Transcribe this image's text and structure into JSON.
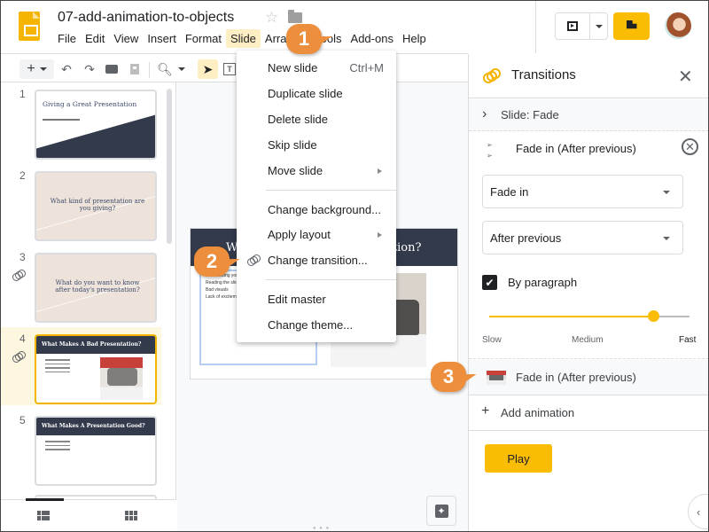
{
  "header": {
    "doc_title": "07-add-animation-to-objects",
    "menu": [
      "File",
      "Edit",
      "View",
      "Insert",
      "Format",
      "Slide",
      "Arrange",
      "Tools",
      "Add-ons",
      "Help"
    ],
    "active_menu": "Slide"
  },
  "toolbar": {
    "items": [
      "new-slide",
      "new-slide-dropdown",
      "undo",
      "redo",
      "print",
      "paint-format",
      "zoom",
      "zoom-dropdown",
      "select",
      "text-box"
    ]
  },
  "filmstrip": {
    "slides": [
      {
        "number": "1",
        "title": "Giving a Great Presentation",
        "has_transition": false
      },
      {
        "number": "2",
        "title": "What kind of presentation are you giving?",
        "has_transition": false
      },
      {
        "number": "3",
        "title": "What do you want to know after today's presentation?",
        "has_transition": true
      },
      {
        "number": "4",
        "title": "What Makes A Bad Presentation?",
        "has_transition": true,
        "selected": true
      },
      {
        "number": "5",
        "title": "What Makes A Presentation Good?",
        "has_transition": false
      }
    ]
  },
  "canvas": {
    "slide_title": "What Makes A Bad Presentation?",
    "bullets": [
      "Not knowing your facts",
      "Reading the slides",
      "Bad visuals",
      "Lack of excitement"
    ]
  },
  "slide_menu": {
    "items": [
      {
        "label": "New slide",
        "shortcut": "Ctrl+M"
      },
      {
        "label": "Duplicate slide"
      },
      {
        "label": "Delete slide"
      },
      {
        "label": "Skip slide"
      },
      {
        "label": "Move slide",
        "submenu": true
      },
      {
        "label": "Change background..."
      },
      {
        "label": "Apply layout",
        "submenu": true
      },
      {
        "label": "Change transition...",
        "icon": "transition-icon"
      },
      {
        "label": "Edit master"
      },
      {
        "label": "Change theme..."
      }
    ]
  },
  "panel": {
    "title": "Transitions",
    "slide_transition": "Slide: Fade",
    "animation_1": {
      "header": "Fade in  (After previous)",
      "effect": "Fade in",
      "trigger": "After previous",
      "by_paragraph_label": "By paragraph",
      "by_paragraph_checked": true,
      "speed_percent": 82,
      "speed_labels": [
        "Slow",
        "Medium",
        "Fast"
      ]
    },
    "animation_2": {
      "label": "Fade in  (After previous)"
    },
    "add_animation": "Add animation",
    "play": "Play"
  },
  "callouts": [
    "1",
    "2",
    "3"
  ],
  "colors": {
    "accent": "#fbbc04",
    "callout": "#ec8e3c",
    "slide_band": "#323a4b"
  }
}
